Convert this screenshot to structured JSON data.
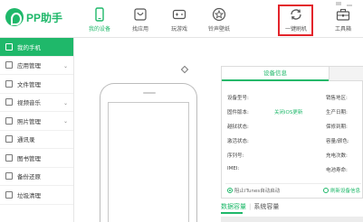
{
  "app": {
    "name": "PP助手",
    "brand_color": "#1fb86a",
    "highlight_color": "#e3242b"
  },
  "nav": [
    {
      "label": "我的设备",
      "icon": "phone-icon",
      "active": true
    },
    {
      "label": "找应用",
      "icon": "app-store-icon",
      "active": false
    },
    {
      "label": "玩游戏",
      "icon": "gamepad-icon",
      "active": false
    },
    {
      "label": "铃声壁纸",
      "icon": "star-badge-icon",
      "active": false
    },
    {
      "label": "一键刷机",
      "icon": "refresh-cycle-icon",
      "active": false,
      "highlighted": true
    },
    {
      "label": "工具箱",
      "icon": "toolbox-icon",
      "active": false
    }
  ],
  "sidebar": {
    "items": [
      {
        "label": "我的手机",
        "icon": "phone-icon",
        "active": true,
        "expandable": false
      },
      {
        "label": "应用管理",
        "icon": "apps-icon",
        "active": false,
        "expandable": true
      },
      {
        "label": "文件管理",
        "icon": "folder-icon",
        "active": false,
        "expandable": false
      },
      {
        "label": "视频音乐",
        "icon": "video-icon",
        "active": false,
        "expandable": true
      },
      {
        "label": "照片管理",
        "icon": "photo-icon",
        "active": false,
        "expandable": true
      },
      {
        "label": "通讯录",
        "icon": "contacts-icon",
        "active": false,
        "expandable": false
      },
      {
        "label": "图书管理",
        "icon": "book-icon",
        "active": false,
        "expandable": false
      },
      {
        "label": "备份还原",
        "icon": "backup-icon",
        "active": false,
        "expandable": false
      },
      {
        "label": "垃圾清理",
        "icon": "trash-icon",
        "active": false,
        "expandable": false
      }
    ]
  },
  "device_info": {
    "tab_label": "设备信息",
    "left_rows": [
      "设备型号:",
      "固件版本:",
      "越狱状态:",
      "激活状态:",
      "序列号:",
      "IMEI:"
    ],
    "right_rows": [
      "销售地区:",
      "生产日期:",
      "保修到期:",
      "容量/颜色:",
      "充电次数:",
      "电池寿命:"
    ],
    "update_link": "关闭iOS更新",
    "itunes_toggle": "阻止iTunes自动启动",
    "refresh_link": "刷新设备信息"
  },
  "capacity": {
    "tab_data": "数据容量",
    "tab_system": "系统容量"
  }
}
